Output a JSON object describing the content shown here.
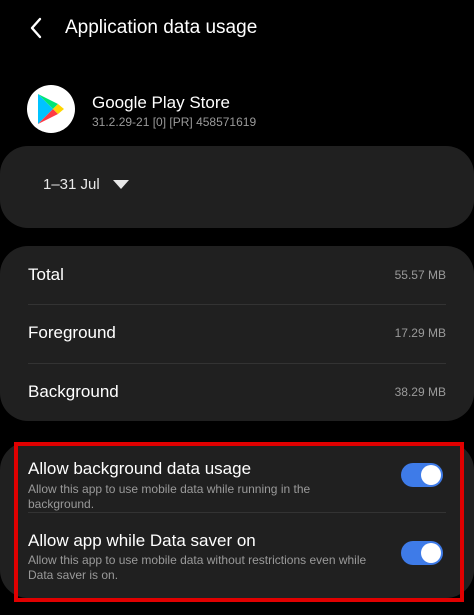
{
  "header": {
    "back_icon": "chevron-left-icon",
    "title": "Application data usage"
  },
  "app": {
    "icon": "google-play-store-icon",
    "name": "Google Play Store",
    "version": "31.2.29-21 [0] [PR] 458571619"
  },
  "date_range": {
    "label": "1–31 Jul",
    "dropdown_icon": "triangle-down-icon"
  },
  "usage": {
    "rows": [
      {
        "label": "Total",
        "value": "55.57 MB"
      },
      {
        "label": "Foreground",
        "value": "17.29 MB"
      },
      {
        "label": "Background",
        "value": "38.29 MB"
      }
    ]
  },
  "settings": {
    "background_data": {
      "title": "Allow background data usage",
      "description": "Allow this app to use mobile data while running in the background.",
      "enabled": true
    },
    "data_saver": {
      "title": "Allow app while Data saver on",
      "description": "Allow this app to use mobile data without restrictions even while Data saver is on.",
      "enabled": true
    }
  },
  "colors": {
    "background": "#000000",
    "card": "#202020",
    "accent": "#3e7be8",
    "highlight": "#e00000",
    "secondary_text": "#9a9a9a"
  }
}
